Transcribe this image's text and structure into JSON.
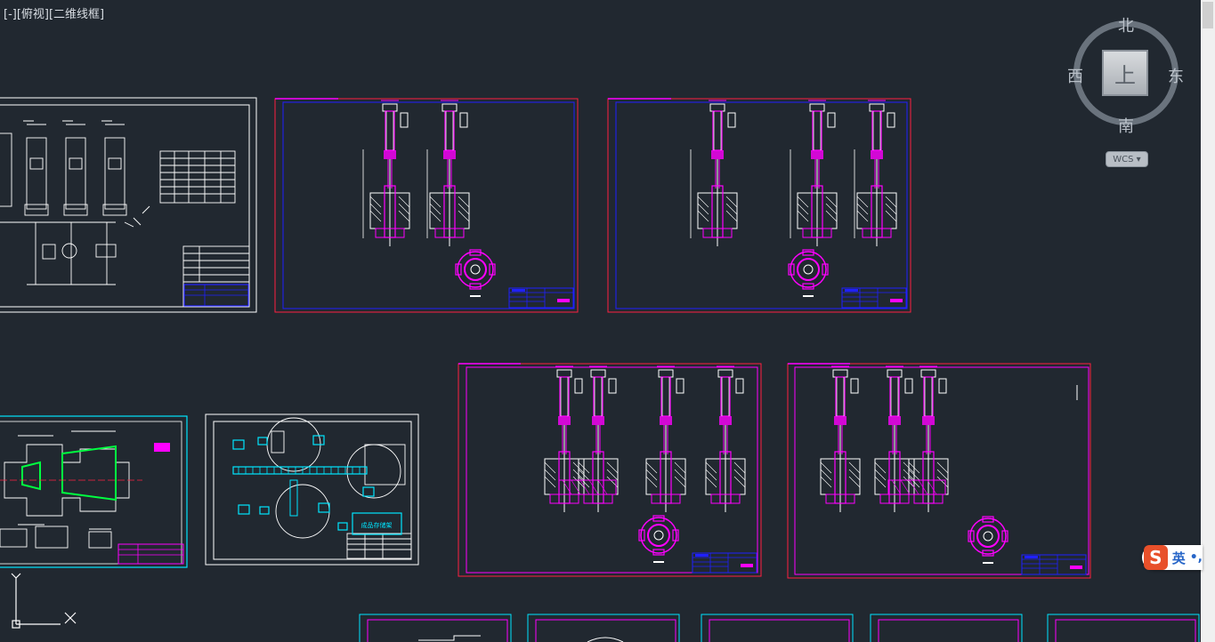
{
  "viewport": {
    "label": "[-][俯视][二维线框]"
  },
  "viewcube": {
    "north": "北",
    "south": "南",
    "west": "西",
    "east": "东",
    "face": "上",
    "wcs": "WCS ▾"
  },
  "ime": {
    "logo": "S",
    "lang": "英",
    "punct": "•,"
  },
  "colors": {
    "background": "#212830",
    "white": "#ffffff",
    "magenta": "#ff00ff",
    "blue": "#2020ff",
    "red": "#ff2040",
    "cyan": "#00e5ff",
    "green": "#00ff40"
  },
  "drawings": {
    "hydraulic_schematic": {
      "icon": "hydraulic-schematic-drawing"
    },
    "cylinder_sheet_1": {
      "icon": "cylinder-assembly-drawing"
    },
    "cylinder_sheet_2": {
      "icon": "cylinder-assembly-drawing"
    },
    "part_drawing": {
      "icon": "machined-part-drawing"
    },
    "layout_plan": {
      "icon": "plant-layout-drawing",
      "storage_label": "成品存储架"
    },
    "cylinder_sheet_3": {
      "icon": "cylinder-assembly-drawing"
    },
    "cylinder_sheet_4": {
      "icon": "cylinder-assembly-drawing"
    }
  }
}
